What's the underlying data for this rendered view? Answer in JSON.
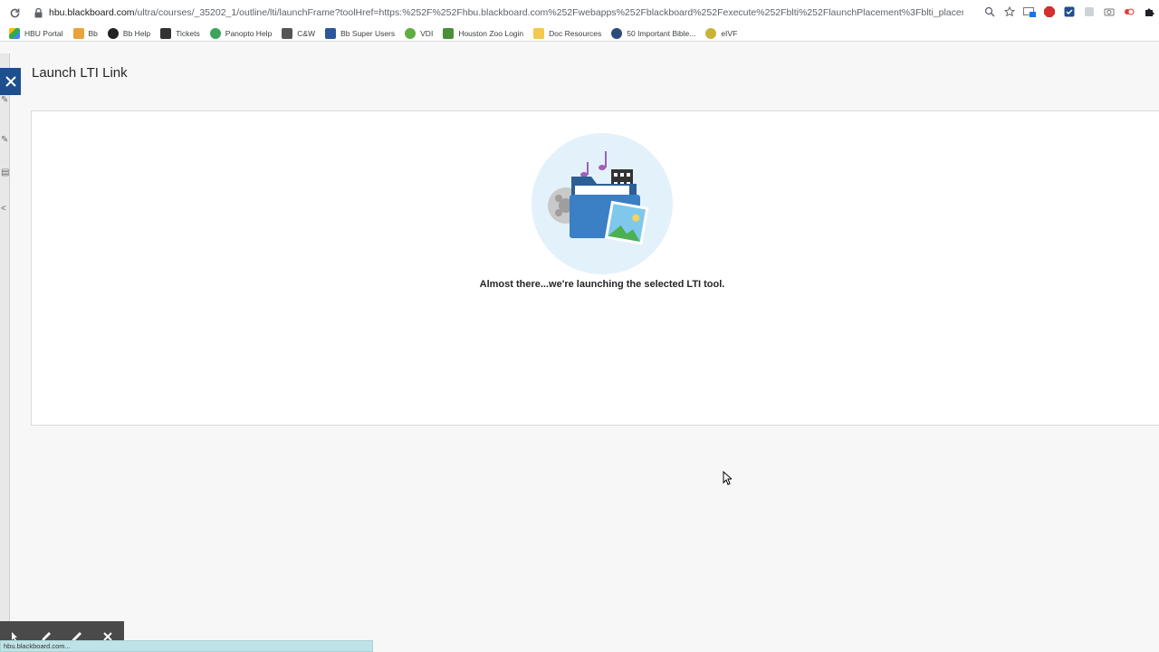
{
  "browser": {
    "url_host": "hbu.blackboard.com",
    "url_path": "/ultra/courses/_35202_1/outline/lti/launchFrame?toolHref=https:%252F%252Fhbu.blackboard.com%252Fwebapps%252Fblackboard%252Fexecute%252Fblti%252FlaunchPlacement%3Fblti_placement_id%3D...",
    "bookmarks": [
      {
        "label": "HBU Portal",
        "color": "#2e7d32"
      },
      {
        "label": "Bb",
        "color": "#e8a33a"
      },
      {
        "label": "Bb Help",
        "color": "#222222"
      },
      {
        "label": "Tickets",
        "color": "#333333"
      },
      {
        "label": "Panopto Help",
        "color": "#3aa35c"
      },
      {
        "label": "C&W",
        "color": "#555555"
      },
      {
        "label": "Bb Super Users",
        "color": "#2b579a"
      },
      {
        "label": "VDI",
        "color": "#5fae3f"
      },
      {
        "label": "Houston Zoo Login",
        "color": "#4a8f3a"
      },
      {
        "label": "Doc Resources",
        "color": "#f2c94c"
      },
      {
        "label": "50 Important Bible...",
        "color": "#2a4b7c"
      },
      {
        "label": "eIVF",
        "color": "#c9b23a"
      }
    ],
    "status_url": "hbu.blackboard.com..."
  },
  "page": {
    "title": "Launch LTI Link",
    "loading_message": "Almost there...we're launching the selected LTI tool."
  },
  "colors": {
    "accent": "#1c4f8c",
    "illustration_bg": "#e3f1fa",
    "folder": "#3b7fc4"
  }
}
